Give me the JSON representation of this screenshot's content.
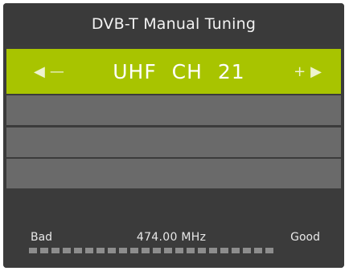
{
  "title": "DVB-T Manual Tuning",
  "selector": {
    "left_arrow": "◀",
    "left_sign": "—",
    "channel": "UHF CH 21",
    "right_sign": "+",
    "right_arrow": "▶"
  },
  "signal": {
    "bad_label": "Bad",
    "frequency": "474.00 MHz",
    "good_label": "Good",
    "segments": 22,
    "level": 0
  },
  "colors": {
    "highlight": "#a8c400",
    "panel": "#3b3b3b",
    "row": "#6a6a6a"
  }
}
